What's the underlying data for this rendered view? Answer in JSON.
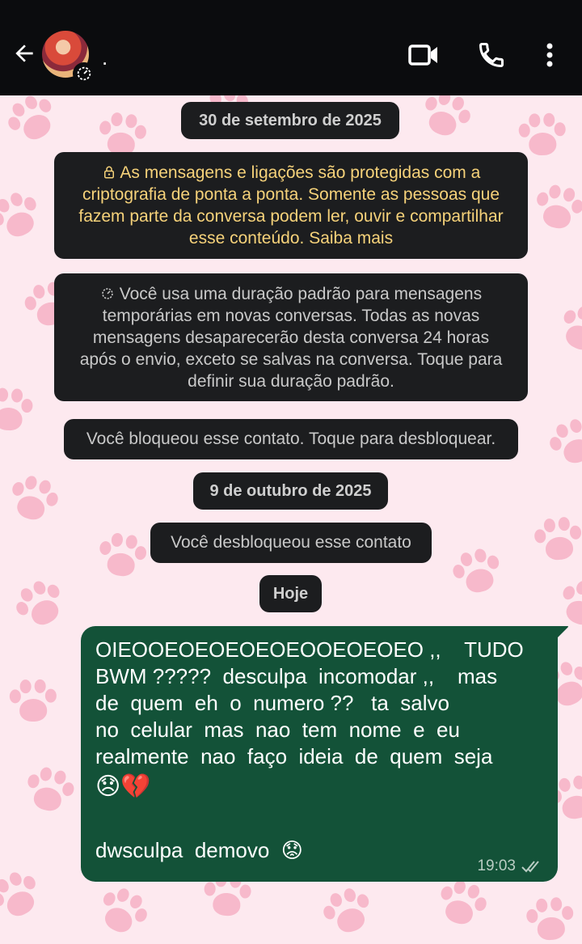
{
  "header": {
    "contact_name": ".",
    "icons": [
      "back-arrow-icon",
      "avatar",
      "timer-icon",
      "video-call-icon",
      "voice-call-icon",
      "more-options-icon"
    ]
  },
  "chat": {
    "date_1": "30 de setembro de 2025",
    "encryption_notice": "As mensagens e ligações são protegidas com a criptografia de ponta a ponta. Somente as pessoas que fazem parte da conversa podem ler, ouvir e compartilhar esse conteúdo. Saiba mais",
    "encryption_lines": [
      "As mensagens e ligações são protegidas com a",
      "criptografia de ponta a ponta. Somente as pessoas que",
      "fazem parte da conversa podem ler, ouvir e compartilhar",
      "esse conteúdo. Saiba mais"
    ],
    "temp_lines": [
      "Você usa uma duração padrão para mensagens",
      "temporárias em novas conversas. Todas as novas",
      "mensagens desaparecerão desta conversa 24 horas",
      "após o envio, exceto se salvas na conversa. Toque para",
      "definir sua duração padrão."
    ],
    "blocked_notice": "Você bloqueou esse contato. Toque para desbloquear.",
    "date_2": "9 de outubro de 2025",
    "unblocked_notice": "Você desbloqueou esse contato",
    "date_3": "Hoje",
    "message": {
      "lines": [
        "OIEOOEOEOEOEOEOOEOEOEO ,,    TUDO",
        "BWM ?????  desculpa  incomodar ,,    mas",
        "de  quem  eh  o  numero ??   ta  salvo",
        "no  celular  mas  nao  tem  nome  e  eu",
        "realmente  nao  faço  ideia  de  quem  seja",
        "😞💔",
        "",
        "dwsculpa  demovo  😟"
      ],
      "time": "19:03",
      "status": "read"
    }
  },
  "colors": {
    "topbar": "#0b0c0e",
    "chip_bg": "#1c1d1f",
    "encryption_text": "#f6d27a",
    "bubble_out": "#135238",
    "wallpaper": "#fde9ef",
    "paw": "#f7b9cb"
  }
}
